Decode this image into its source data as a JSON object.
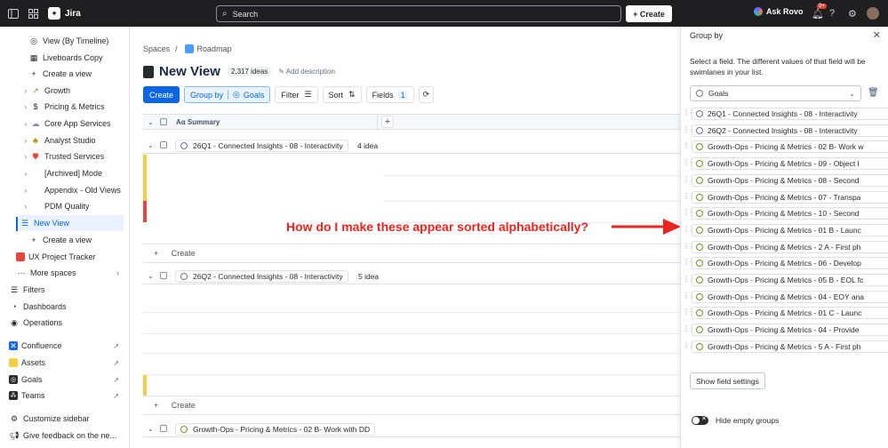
{
  "topbar": {
    "app_name": "Jira",
    "search_placeholder": "Search",
    "create_label": "+ Create",
    "rovo_label": "Ask Rovo",
    "notif_badge": "9+"
  },
  "sidebar": {
    "items": [
      {
        "label": "View (By Timeline)"
      },
      {
        "label": "Liveboards Copy"
      },
      {
        "label": "Create a view"
      },
      {
        "label": "Growth"
      },
      {
        "label": "Pricing & Metrics"
      },
      {
        "label": "Core App Services"
      },
      {
        "label": "Analyst Studio"
      },
      {
        "label": "Trusted Services"
      },
      {
        "label": "[Archived] Mode"
      },
      {
        "label": "Appendix - Old Views"
      },
      {
        "label": "PDM Quality"
      },
      {
        "label": "New View"
      },
      {
        "label": "Create a view"
      },
      {
        "label": "UX Project Tracker"
      },
      {
        "label": "More spaces"
      },
      {
        "label": "Filters"
      },
      {
        "label": "Dashboards"
      },
      {
        "label": "Operations"
      },
      {
        "label": "Confluence"
      },
      {
        "label": "Assets"
      },
      {
        "label": "Goals"
      },
      {
        "label": "Teams"
      },
      {
        "label": "Customize sidebar"
      },
      {
        "label": "Give feedback on the ne..."
      }
    ]
  },
  "main": {
    "breadcrumb": {
      "spaces": "Spaces",
      "sep": "/",
      "roadmap": "Roadmap"
    },
    "title": "New View",
    "ideas_count": "2,317 ideas",
    "add_description": "Add description",
    "toolbar": {
      "create": "Create",
      "group_by": "Group by",
      "group_by_value": "Goals",
      "filter": "Filter",
      "sort": "Sort",
      "fields": "Fields",
      "fields_count": "1"
    },
    "grid": {
      "summary_header": "Summary"
    },
    "groups": [
      {
        "label": "26Q1 - Connected Insights - 08 - Interactivity",
        "count": "4 idea"
      },
      {
        "label": "26Q2 - Connected Insights - 08 - Interactivity",
        "count": "5 idea"
      },
      {
        "label": "Growth-Ops - Pricing & Metrics - 02 B- Work with DD",
        "count": ""
      }
    ],
    "create_row": "Create"
  },
  "annotation": "How do I make these appear sorted alphabetically?",
  "panel": {
    "title": "Group by",
    "description": "Select a field. The different values of that field will be swimlanes in your list.",
    "selected_field": "Goals",
    "items": [
      "26Q1 - Connected Insights - 08 - Interactivity",
      "26Q2 - Connected Insights - 08 - Interactivity",
      "Growth-Ops - Pricing & Metrics - 02 B- Work w",
      "Growth-Ops - Pricing & Metrics - 09 - Object l",
      "Growth-Ops - Pricing & Metrics - 08 - Second",
      "Growth-Ops - Pricing & Metrics - 07 - Transpa",
      "Growth-Ops - Pricing & Metrics - 10 - Second",
      "Growth-Ops - Pricing & Metrics - 01 B - Launc",
      "Growth-Ops - Pricing & Metrics - 2 A - First ph",
      "Growth-Ops - Pricing & Metrics - 06 - Develop",
      "Growth-Ops - Pricing & Metrics - 05 B - EOL fc",
      "Growth-Ops - Pricing & Metrics - 04 - EOY ana",
      "Growth-Ops - Pricing & Metrics - 01 C - Launc",
      "Growth-Ops - Pricing & Metrics - 04 - Provide",
      "Growth-Ops - Pricing & Metrics - 5 A - First ph"
    ],
    "show_field_settings": "Show field settings",
    "hide_empty_groups": "Hide empty groups"
  },
  "colors": {
    "accent": "#0c66e4",
    "annotation": "#e8251f",
    "topbar": "#1f1f21",
    "stripe_yellow": "#f5cd47",
    "stripe_red": "#e2483d"
  }
}
